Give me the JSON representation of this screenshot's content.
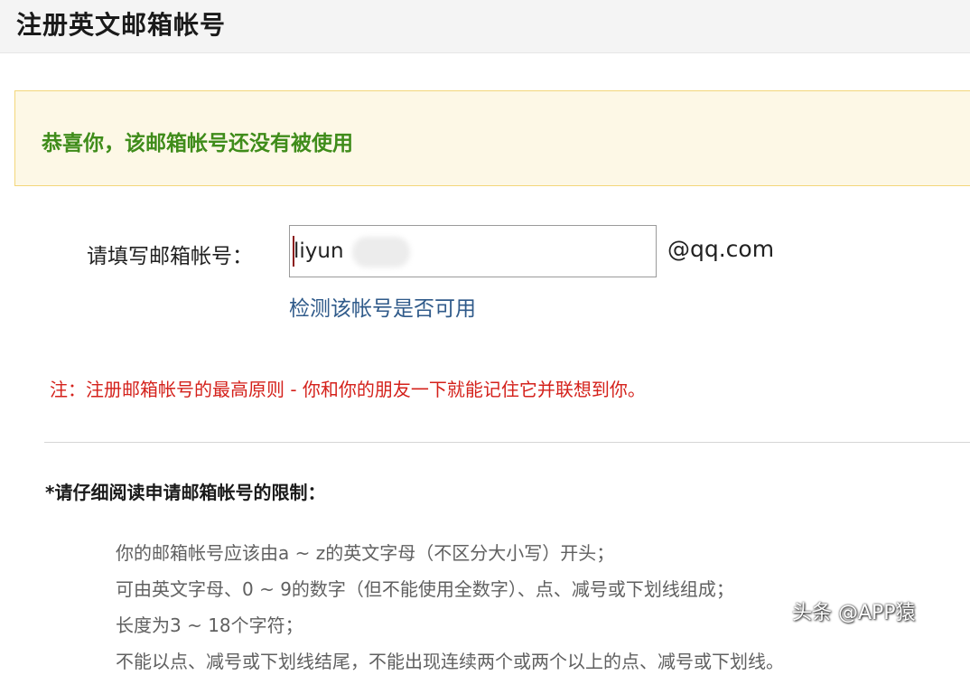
{
  "header": {
    "title": "注册英文邮箱帐号"
  },
  "notice": {
    "text": "恭喜你，该邮箱帐号还没有被使用"
  },
  "form": {
    "label": "请填写邮箱帐号：",
    "input_value": "liyun",
    "domain_suffix": "@qq.com",
    "check_link": "检测该帐号是否可用"
  },
  "note": {
    "text": "注：注册邮箱帐号的最高原则 - 你和你的朋友一下就能记住它并联想到你。"
  },
  "restrictions": {
    "title": "*请仔细阅读申请邮箱帐号的限制：",
    "items": [
      "你的邮箱帐号应该由a ~ z的英文字母（不区分大小写）开头；",
      "可由英文字母、0 ~ 9的数字（但不能使用全数字）、点、减号或下划线组成；",
      "长度为3 ~ 18个字符；",
      "不能以点、减号或下划线结尾，不能出现连续两个或两个以上的点、减号或下划线。"
    ]
  },
  "watermark": {
    "text": "头条 @APP猿"
  },
  "colors": {
    "notice_text": "#3f8c1a",
    "notice_bg": "#fdf8e6",
    "notice_border": "#f3d67a",
    "link": "#2f5a8a",
    "warning": "#d4211b"
  }
}
